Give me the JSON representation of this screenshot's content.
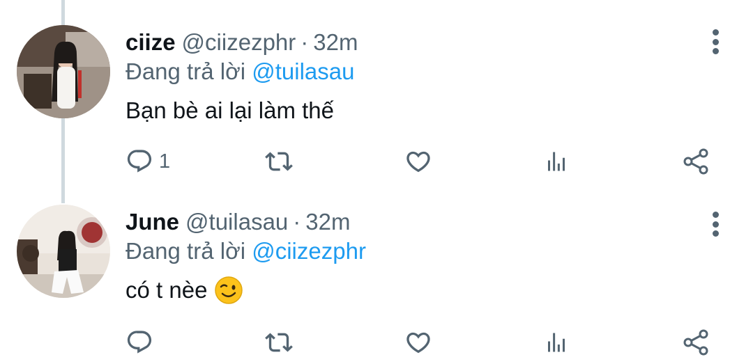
{
  "tweets": [
    {
      "display_name": "ciize",
      "handle": "@ciizezphr",
      "separator": "·",
      "time": "32m",
      "reply_prefix": "Đang trả lời ",
      "reply_to": "@tuilasau",
      "text": "Bạn bè ai lại làm thế",
      "reply_count": "1",
      "emoji": ""
    },
    {
      "display_name": "June",
      "handle": "@tuilasau",
      "separator": "·",
      "time": "32m",
      "reply_prefix": "Đang trả lời ",
      "reply_to": "@ciizezphr",
      "text": "có t nèe",
      "reply_count": "",
      "emoji": "wink-emoji"
    }
  ],
  "icons": {
    "reply": "reply-icon",
    "retweet": "retweet-icon",
    "like": "heart-icon",
    "views": "analytics-icon",
    "share": "share-icon",
    "more": "more-vertical-icon"
  },
  "colors": {
    "text_primary": "#0f1419",
    "text_secondary": "#536471",
    "mention": "#1d9bf0",
    "thread_line": "#cfd9de"
  }
}
